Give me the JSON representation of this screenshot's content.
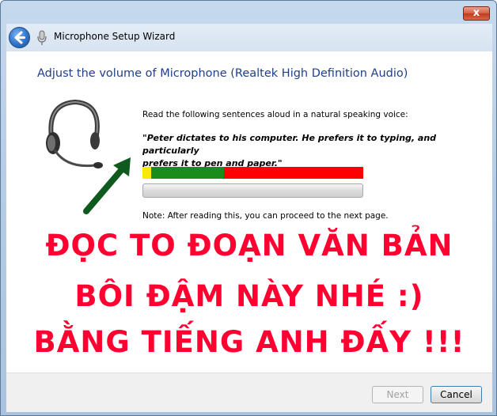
{
  "window": {
    "title": "Microphone Setup Wizard",
    "close_glyph": "x"
  },
  "main": {
    "heading": "Adjust the volume of Microphone (Realtek High Definition Audio)",
    "instruction": "Read the following sentences aloud in a natural speaking voice:",
    "quote_line1": "\"Peter dictates to his computer. He prefers it to typing, and particularly",
    "quote_line2": "prefers it to pen and paper.\"",
    "note": "Note: After reading this, you can proceed to the next page.",
    "level_meter": {
      "yellow_fraction": 0.04,
      "green_fraction": 0.33,
      "colors": {
        "yellow": "#ffe800",
        "green": "#1a8c1a",
        "red": "#ff0000"
      }
    },
    "progress": {
      "fraction": 0
    }
  },
  "overlay": {
    "line1": "ĐỌC TO ĐOẠN VĂN BẢN",
    "line2": "BÔI ĐẬM NÀY NHÉ :)",
    "line3": "BẰNG TIẾNG ANH ĐẤY !!!",
    "color": "#ff0030",
    "arrow_color": "#0f5a1e"
  },
  "footer": {
    "next_label": "Next",
    "cancel_label": "Cancel"
  },
  "icons": [
    "back-arrow-icon",
    "microphone-icon",
    "headset-icon",
    "close-icon"
  ]
}
